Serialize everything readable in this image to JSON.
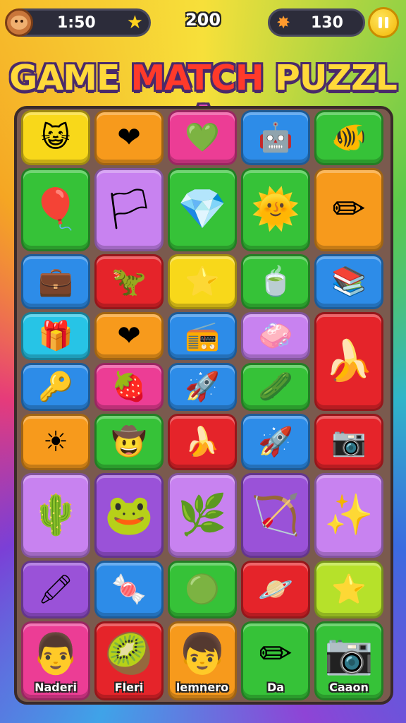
{
  "hud": {
    "timer": "1:50",
    "score": "200",
    "coins": "130"
  },
  "title": {
    "word1": "GAME",
    "word2": "MATCH",
    "word3": "PUZZL",
    "word4": "A"
  },
  "colors": {
    "yellow": "#f8d81a",
    "orange": "#f79a1c",
    "pink": "#ec3d95",
    "blue": "#2d8ce8",
    "green": "#36c238",
    "purple": "#9a52d8",
    "lilac": "#c882f0",
    "red": "#e5242a",
    "cyan": "#27c4e6",
    "lime": "#b6e12a"
  },
  "tiles": [
    {
      "id": "r1c1",
      "icon": "cat-face-icon",
      "glyph": "😺",
      "color": "yellow"
    },
    {
      "id": "r1c2",
      "icon": "heart-icon",
      "glyph": "❤",
      "color": "orange"
    },
    {
      "id": "r1c3",
      "icon": "green-heart-icon",
      "glyph": "💚",
      "color": "pink"
    },
    {
      "id": "r1c4",
      "icon": "robot-face-icon",
      "glyph": "🤖",
      "color": "blue"
    },
    {
      "id": "r1c5",
      "icon": "orange-fish-icon",
      "glyph": "🐠",
      "color": "green"
    },
    {
      "id": "r2c1",
      "icon": "red-balloon-icon",
      "glyph": "🎈",
      "color": "green"
    },
    {
      "id": "r2c2",
      "icon": "blue-flag-icon",
      "glyph": "🏳",
      "color": "lilac"
    },
    {
      "id": "r2c3",
      "icon": "green-gem-icon",
      "glyph": "💎",
      "color": "green"
    },
    {
      "id": "r2c4",
      "icon": "smiling-sun-icon",
      "glyph": "🌞",
      "color": "green"
    },
    {
      "id": "r2c5",
      "icon": "pencil-icon",
      "glyph": "✏",
      "color": "orange"
    },
    {
      "id": "r3c1",
      "icon": "briefcase-icon",
      "glyph": "💼",
      "color": "blue"
    },
    {
      "id": "r3c2",
      "icon": "dinosaur-icon",
      "glyph": "🦖",
      "color": "red"
    },
    {
      "id": "r3c3",
      "icon": "silver-star-icon",
      "glyph": "⭐",
      "color": "yellow"
    },
    {
      "id": "r3c4",
      "icon": "green-pot-icon",
      "glyph": "🍵",
      "color": "green"
    },
    {
      "id": "r3c5",
      "icon": "book-stack-icon",
      "glyph": "📚",
      "color": "blue"
    },
    {
      "id": "r4c1",
      "icon": "gift-box-icon",
      "glyph": "🎁",
      "color": "cyan"
    },
    {
      "id": "r4c2",
      "icon": "heart-icon",
      "glyph": "❤",
      "color": "orange"
    },
    {
      "id": "r4c3",
      "icon": "radio-icon",
      "glyph": "📻",
      "color": "blue"
    },
    {
      "id": "r4c4",
      "icon": "pink-eraser-icon",
      "glyph": "🧼",
      "color": "lilac"
    },
    {
      "id": "r4c5",
      "icon": "banana-icon",
      "glyph": "🍌",
      "color": "red"
    },
    {
      "id": "r5c1",
      "icon": "usb-key-icon",
      "glyph": "🔑",
      "color": "blue"
    },
    {
      "id": "r5c2",
      "icon": "strawberry-heart-icon",
      "glyph": "🍓",
      "color": "pink"
    },
    {
      "id": "r5c3",
      "icon": "paper-plane-icon",
      "glyph": "🚀",
      "color": "blue"
    },
    {
      "id": "r5c4",
      "icon": "cucumber-icon",
      "glyph": "🥒",
      "color": "green"
    },
    {
      "id": "r6c1",
      "icon": "sun-icon",
      "glyph": "☀",
      "color": "orange"
    },
    {
      "id": "r6c2",
      "icon": "cowboy-face-icon",
      "glyph": "🤠",
      "color": "green"
    },
    {
      "id": "r6c3",
      "icon": "banana-icon",
      "glyph": "🍌",
      "color": "red"
    },
    {
      "id": "r6c4",
      "icon": "rocket-icon",
      "glyph": "🚀",
      "color": "blue"
    },
    {
      "id": "r6c5",
      "icon": "camera-icon",
      "glyph": "📷",
      "color": "red"
    },
    {
      "id": "r7c1",
      "icon": "cactus-icon",
      "glyph": "🌵",
      "color": "lilac"
    },
    {
      "id": "r7c2",
      "icon": "monster-face-icon",
      "glyph": "🐸",
      "color": "purple"
    },
    {
      "id": "r7c3",
      "icon": "plant-hand-icon",
      "glyph": "🌿",
      "color": "lilac"
    },
    {
      "id": "r7c4",
      "icon": "hero-arrows-icon",
      "glyph": "🏹",
      "color": "purple"
    },
    {
      "id": "r7c5",
      "icon": "molecule-icon",
      "glyph": "✨",
      "color": "lilac"
    },
    {
      "id": "r8c1",
      "icon": "marker-icon",
      "glyph": "🖍",
      "color": "purple"
    },
    {
      "id": "r8c2",
      "icon": "candy-icon",
      "glyph": "🍬",
      "color": "blue"
    },
    {
      "id": "r8c3",
      "icon": "green-blob-icon",
      "glyph": "🟢",
      "color": "green"
    },
    {
      "id": "r8c4",
      "icon": "planet-icon",
      "glyph": "🪐",
      "color": "red"
    },
    {
      "id": "r8c5",
      "icon": "gold-star-icon",
      "glyph": "⭐",
      "color": "lime"
    },
    {
      "id": "r9c1",
      "icon": "chef-face-icon",
      "glyph": "👨",
      "color": "pink",
      "label": "Naderi"
    },
    {
      "id": "r9c2",
      "icon": "lime-monster-icon",
      "glyph": "🥝",
      "color": "red",
      "label": "Fleri"
    },
    {
      "id": "r9c3",
      "icon": "boy-face-icon",
      "glyph": "👦",
      "color": "orange",
      "label": "lemnero"
    },
    {
      "id": "r9c4",
      "icon": "pencil-icon",
      "glyph": "✏",
      "color": "green",
      "label": "Da"
    },
    {
      "id": "r9c5",
      "icon": "robot-camera-icon",
      "glyph": "📷",
      "color": "green",
      "label": "Caaon"
    }
  ]
}
